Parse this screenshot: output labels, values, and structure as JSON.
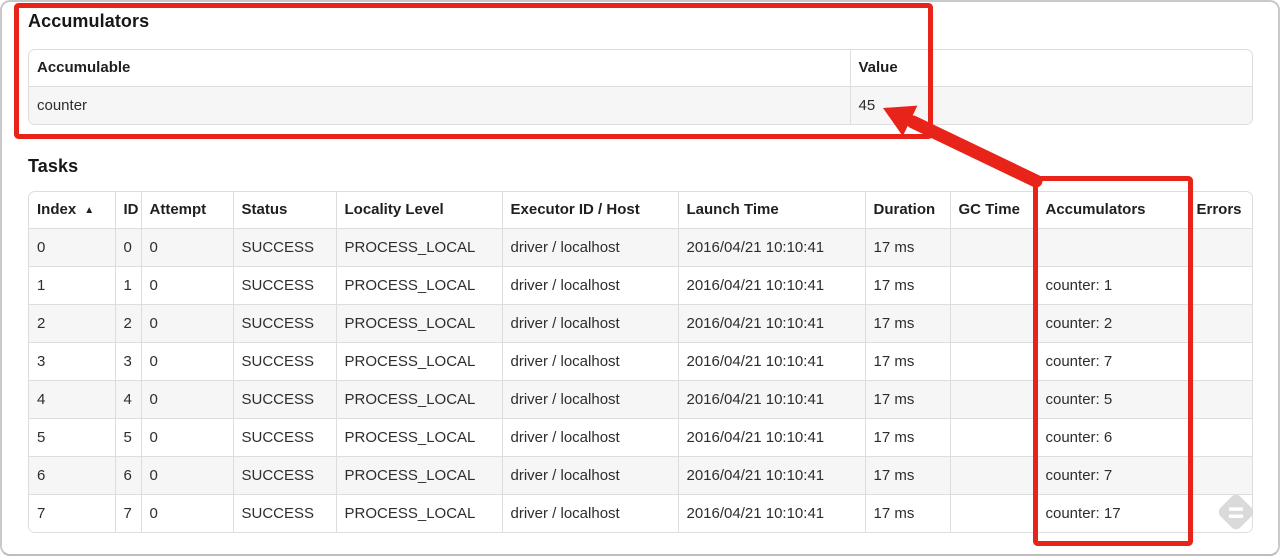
{
  "accumulators_section": {
    "title": "Accumulators",
    "table": {
      "headers": {
        "accumulable": "Accumulable",
        "value": "Value"
      },
      "rows": [
        {
          "accumulable": "counter",
          "value": "45"
        }
      ]
    }
  },
  "tasks_section": {
    "title": "Tasks",
    "columns": {
      "index": "Index",
      "id": "ID",
      "attempt": "Attempt",
      "status": "Status",
      "locality": "Locality Level",
      "executor": "Executor ID / Host",
      "launch": "Launch Time",
      "duration": "Duration",
      "gc": "GC Time",
      "accumulators": "Accumulators",
      "errors": "Errors"
    },
    "sort_icon": "▲",
    "rows": [
      {
        "index": "0",
        "id": "0",
        "attempt": "0",
        "status": "SUCCESS",
        "locality": "PROCESS_LOCAL",
        "executor": "driver / localhost",
        "launch": "2016/04/21 10:10:41",
        "duration": "17 ms",
        "gc": "",
        "accumulators": "",
        "errors": ""
      },
      {
        "index": "1",
        "id": "1",
        "attempt": "0",
        "status": "SUCCESS",
        "locality": "PROCESS_LOCAL",
        "executor": "driver / localhost",
        "launch": "2016/04/21 10:10:41",
        "duration": "17 ms",
        "gc": "",
        "accumulators": "counter: 1",
        "errors": ""
      },
      {
        "index": "2",
        "id": "2",
        "attempt": "0",
        "status": "SUCCESS",
        "locality": "PROCESS_LOCAL",
        "executor": "driver / localhost",
        "launch": "2016/04/21 10:10:41",
        "duration": "17 ms",
        "gc": "",
        "accumulators": "counter: 2",
        "errors": ""
      },
      {
        "index": "3",
        "id": "3",
        "attempt": "0",
        "status": "SUCCESS",
        "locality": "PROCESS_LOCAL",
        "executor": "driver / localhost",
        "launch": "2016/04/21 10:10:41",
        "duration": "17 ms",
        "gc": "",
        "accumulators": "counter: 7",
        "errors": ""
      },
      {
        "index": "4",
        "id": "4",
        "attempt": "0",
        "status": "SUCCESS",
        "locality": "PROCESS_LOCAL",
        "executor": "driver / localhost",
        "launch": "2016/04/21 10:10:41",
        "duration": "17 ms",
        "gc": "",
        "accumulators": "counter: 5",
        "errors": ""
      },
      {
        "index": "5",
        "id": "5",
        "attempt": "0",
        "status": "SUCCESS",
        "locality": "PROCESS_LOCAL",
        "executor": "driver / localhost",
        "launch": "2016/04/21 10:10:41",
        "duration": "17 ms",
        "gc": "",
        "accumulators": "counter: 6",
        "errors": ""
      },
      {
        "index": "6",
        "id": "6",
        "attempt": "0",
        "status": "SUCCESS",
        "locality": "PROCESS_LOCAL",
        "executor": "driver / localhost",
        "launch": "2016/04/21 10:10:41",
        "duration": "17 ms",
        "gc": "",
        "accumulators": "counter: 7",
        "errors": ""
      },
      {
        "index": "7",
        "id": "7",
        "attempt": "0",
        "status": "SUCCESS",
        "locality": "PROCESS_LOCAL",
        "executor": "driver / localhost",
        "launch": "2016/04/21 10:10:41",
        "duration": "17 ms",
        "gc": "",
        "accumulators": "counter: 17",
        "errors": ""
      }
    ]
  },
  "annotations": {
    "color": "#e8231a"
  },
  "watermark": {
    "color": "#d9d9d9",
    "stripe_color": "#ffffff"
  }
}
